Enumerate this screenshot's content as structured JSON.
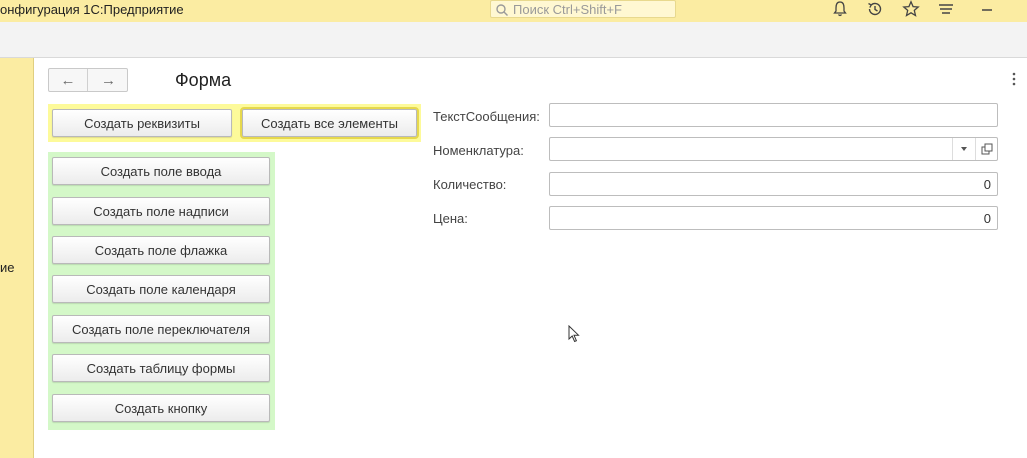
{
  "app": {
    "title": "онфигурация 1С:Предприятие"
  },
  "search": {
    "placeholder": "Поиск Ctrl+Shift+F"
  },
  "titlebar_icons": [
    "bell-icon",
    "history-icon",
    "star-icon",
    "menu-icon",
    "minimize-icon"
  ],
  "sidebar": {
    "label": "ие"
  },
  "form": {
    "title": "Форма",
    "nav": {
      "back": "←",
      "forward": "→"
    },
    "top_buttons": [
      {
        "label": "Создать реквизиты"
      },
      {
        "label": "Создать все элементы"
      }
    ],
    "green_buttons": [
      {
        "label": "Создать поле ввода"
      },
      {
        "label": "Создать поле надписи"
      },
      {
        "label": "Создать поле флажка"
      },
      {
        "label": "Создать поле календаря"
      },
      {
        "label": "Создать поле переключателя"
      },
      {
        "label": "Создать таблицу формы"
      },
      {
        "label": "Создать кнопку"
      }
    ],
    "fields": {
      "message": {
        "label": "ТекстСообщения:",
        "value": ""
      },
      "nomenclature": {
        "label": "Номенклатура:",
        "value": ""
      },
      "quantity": {
        "label": "Количество:",
        "value": "0"
      },
      "price": {
        "label": "Цена:",
        "value": "0"
      }
    }
  },
  "colors": {
    "titlebar": "#fbeca2",
    "yellow_group": "#fdfa9a",
    "green_group": "#d4f8c8"
  }
}
